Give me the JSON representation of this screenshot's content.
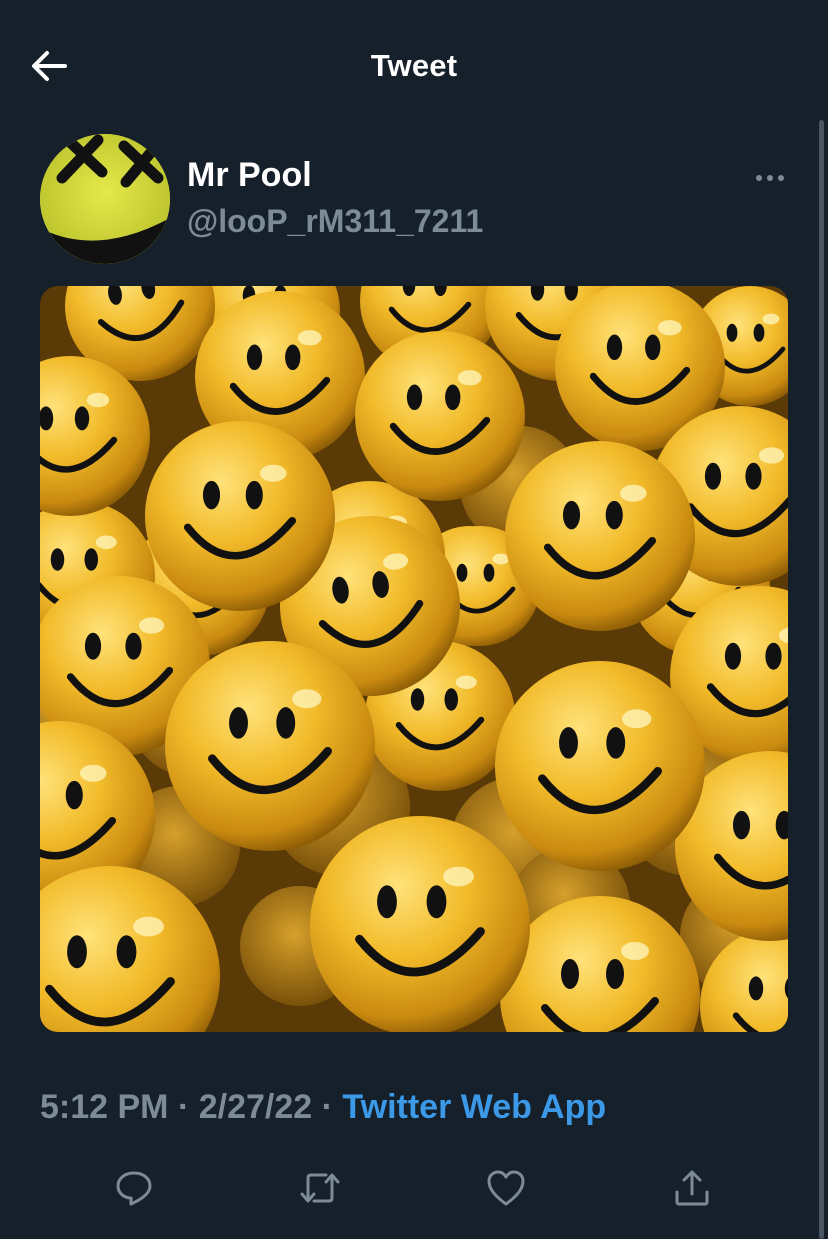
{
  "header": {
    "title": "Tweet",
    "back_icon": "arrow-left-icon"
  },
  "author": {
    "display_name": "Mr Pool",
    "handle": "@looP_rM311_7211",
    "avatar_icon": "smiley-x-eyes-avatar",
    "more_icon": "more-horizontal-icon"
  },
  "media": {
    "subject": "smiley-face-balls-image"
  },
  "meta": {
    "time": "5:12 PM",
    "sep1": " · ",
    "date": "2/27/22",
    "sep2": " · ",
    "source": "Twitter Web App"
  },
  "actions": [
    {
      "icon": "reply-icon"
    },
    {
      "icon": "retweet-icon"
    },
    {
      "icon": "like-icon"
    },
    {
      "icon": "share-icon"
    }
  ],
  "colors": {
    "background": "#15202b",
    "secondary_text": "#7d8b98",
    "link": "#3b99e8",
    "smiley": "#e8b022"
  }
}
